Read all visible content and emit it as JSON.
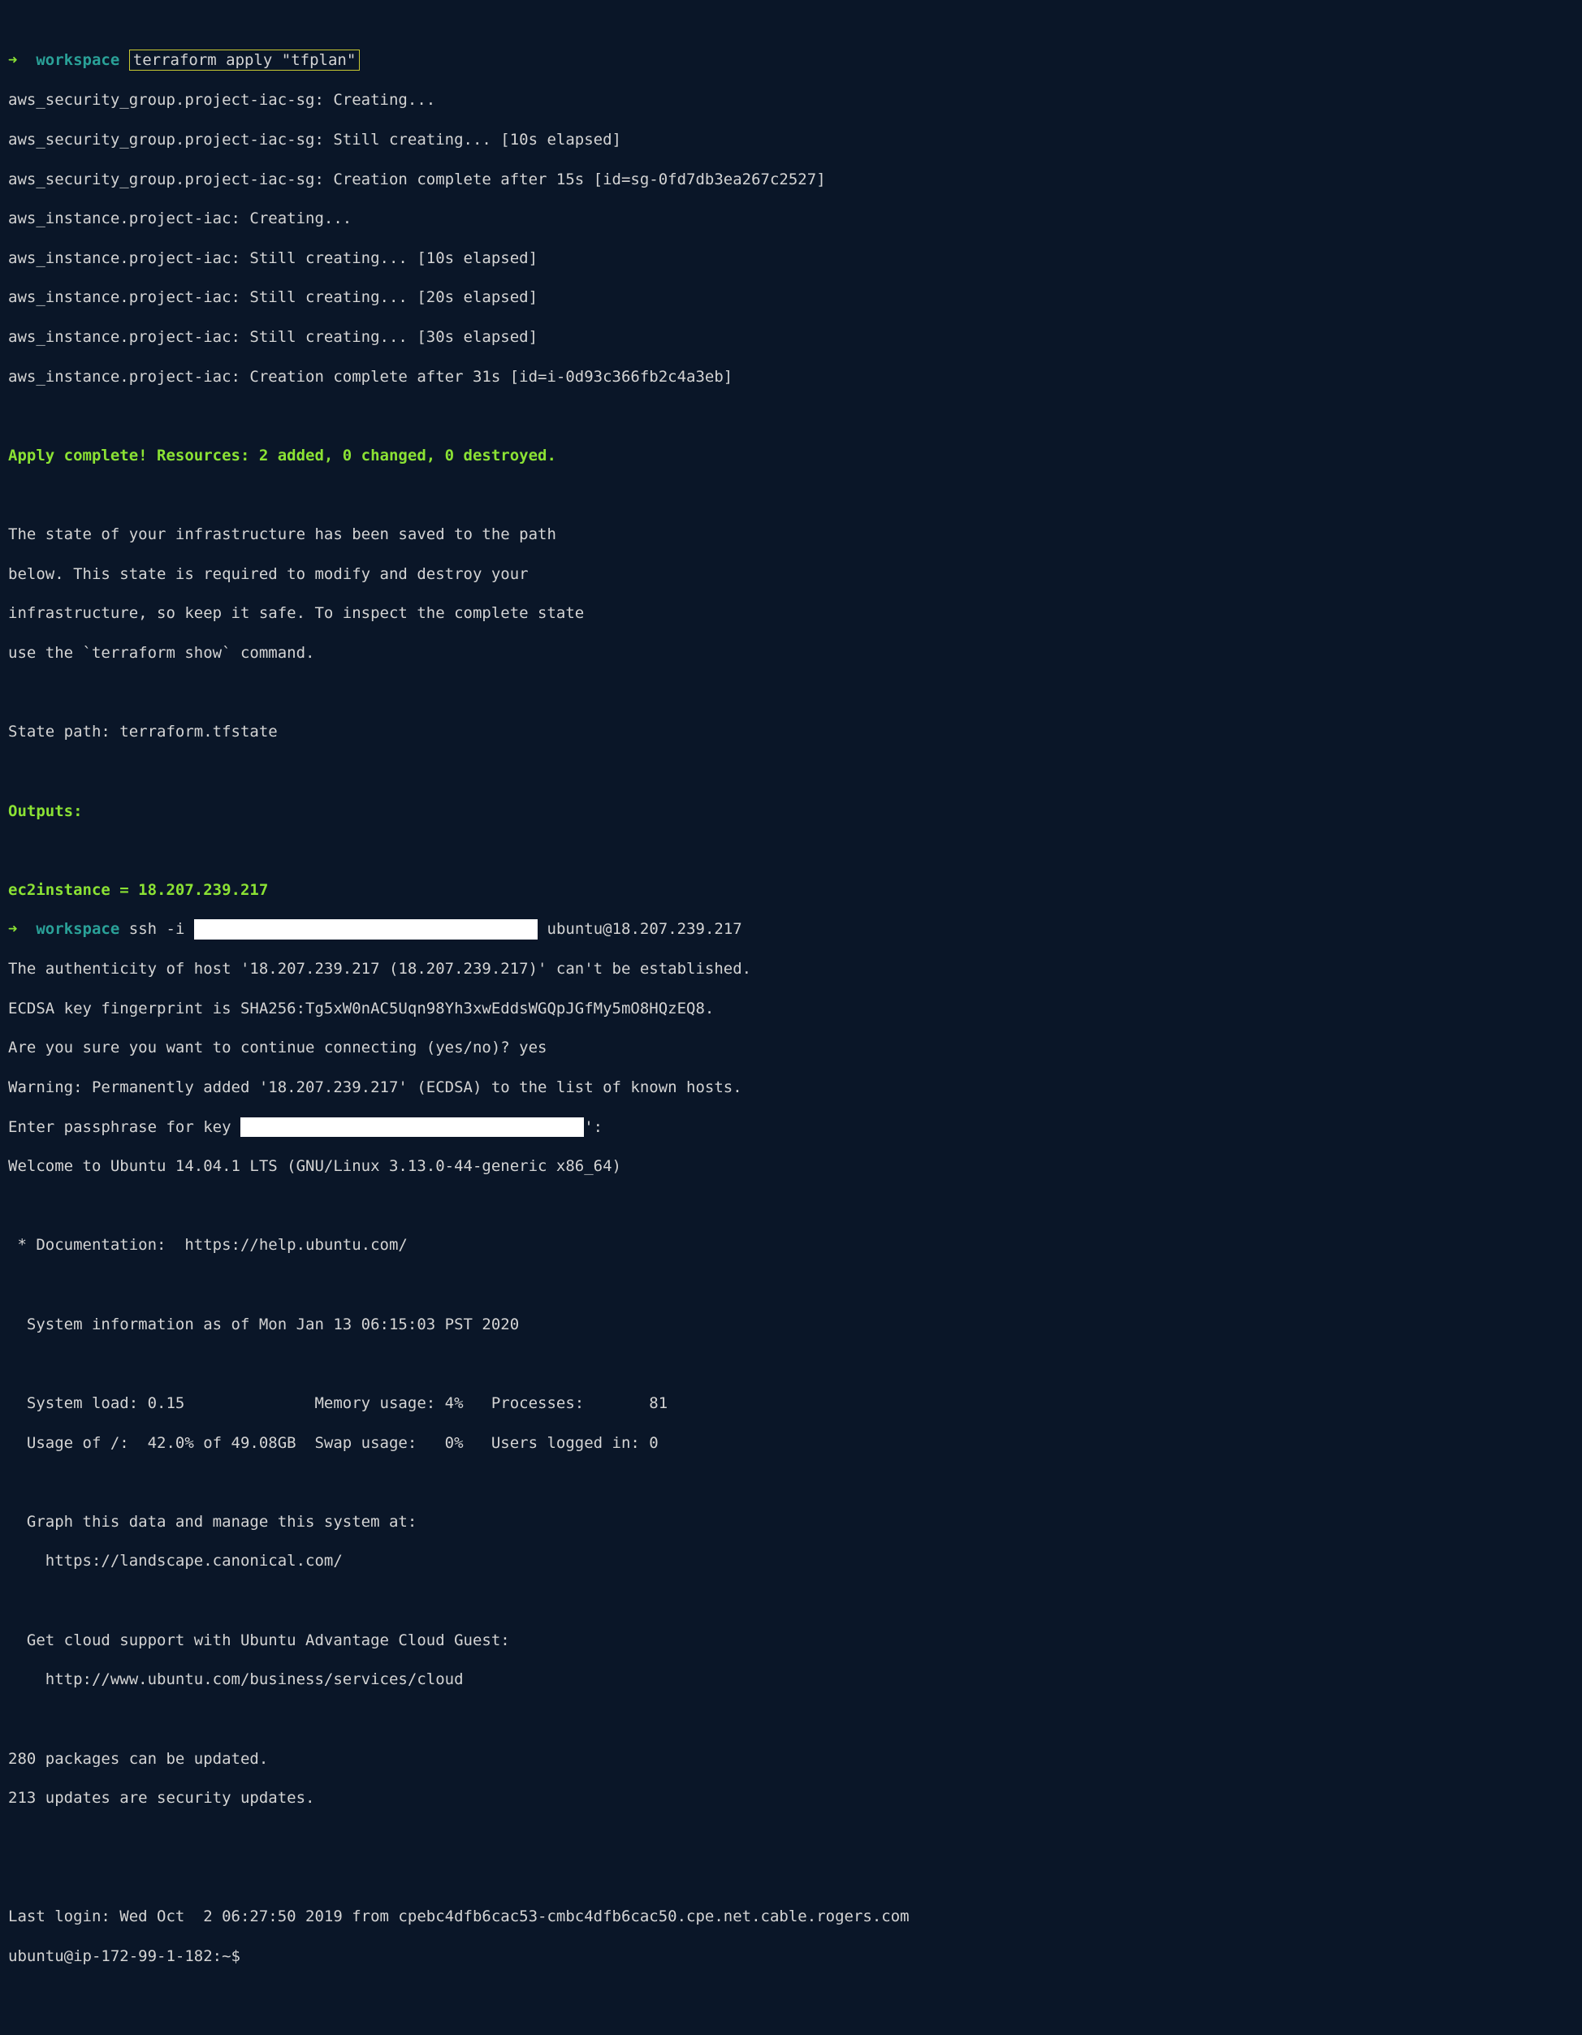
{
  "prompt1": {
    "arrow": "➜",
    "cwd": "workspace",
    "cmd": "terraform apply \"tfplan\""
  },
  "tfout": {
    "l1": "aws_security_group.project-iac-sg: Creating...",
    "l2": "aws_security_group.project-iac-sg: Still creating... [10s elapsed]",
    "l3": "aws_security_group.project-iac-sg: Creation complete after 15s [id=sg-0fd7db3ea267c2527]",
    "l4": "aws_instance.project-iac: Creating...",
    "l5": "aws_instance.project-iac: Still creating... [10s elapsed]",
    "l6": "aws_instance.project-iac: Still creating... [20s elapsed]",
    "l7": "aws_instance.project-iac: Still creating... [30s elapsed]",
    "l8": "aws_instance.project-iac: Creation complete after 31s [id=i-0d93c366fb2c4a3eb]"
  },
  "apply_complete": "Apply complete! Resources: 2 added, 0 changed, 0 destroyed.",
  "state_msg": {
    "l1": "The state of your infrastructure has been saved to the path",
    "l2": "below. This state is required to modify and destroy your",
    "l3": "infrastructure, so keep it safe. To inspect the complete state",
    "l4": "use the `terraform show` command.",
    "l5": "State path: terraform.tfstate"
  },
  "outputs_header": "Outputs:",
  "outputs_var": "ec2instance = 18.207.239.217",
  "prompt2": {
    "arrow": "➜",
    "cwd": "workspace",
    "cmd_pre": "ssh -i ",
    "redacted_pad": "                                     ",
    "cmd_post": " ubuntu@18.207.239.217"
  },
  "ssh": {
    "l1": "The authenticity of host '18.207.239.217 (18.207.239.217)' can't be established.",
    "l2": "ECDSA key fingerprint is SHA256:Tg5xW0nAC5Uqn98Yh3xwEddsWGQpJGfMy5mO8HQzEQ8.",
    "l3": "Are you sure you want to continue connecting (yes/no)? yes",
    "l4": "Warning: Permanently added '18.207.239.217' (ECDSA) to the list of known hosts.",
    "l5_pre": "Enter passphrase for key ",
    "l5_redacted": "                                     ",
    "l5_post": "':",
    "l6": "Welcome to Ubuntu 14.04.1 LTS (GNU/Linux 3.13.0-44-generic x86_64)"
  },
  "motd": {
    "doc": " * Documentation:  https://help.ubuntu.com/",
    "sysinfo_header": "  System information as of Mon Jan 13 06:15:03 PST 2020",
    "row1": "  System load: 0.15              Memory usage: 4%   Processes:       81",
    "row2": "  Usage of /:  42.0% of 49.08GB  Swap usage:   0%   Users logged in: 0",
    "graph1": "  Graph this data and manage this system at:",
    "graph2": "    https://landscape.canonical.com/",
    "cloud1": "  Get cloud support with Ubuntu Advantage Cloud Guest:",
    "cloud2": "    http://www.ubuntu.com/business/services/cloud",
    "pkg1": "280 packages can be updated.",
    "pkg2": "213 updates are security updates.",
    "lastlogin": "Last login: Wed Oct  2 06:27:50 2019 from cpebc4dfb6cac53-cmbc4dfb6cac50.cpe.net.cable.rogers.com",
    "shellprompt": "ubuntu@ip-172-99-1-182:~$"
  }
}
